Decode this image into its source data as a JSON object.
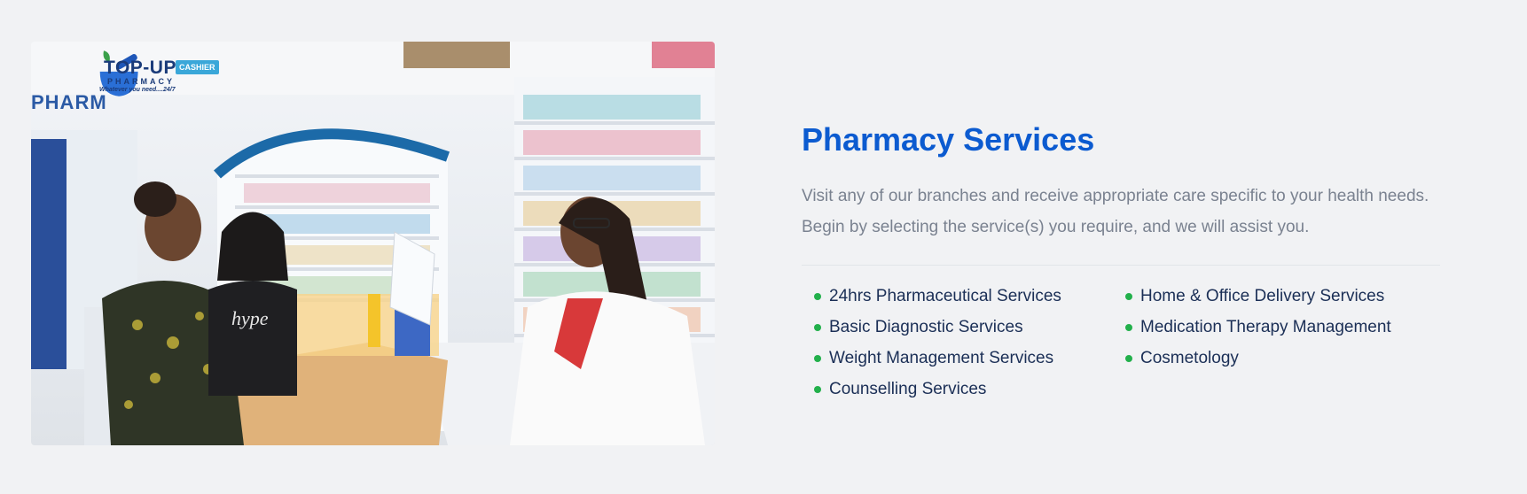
{
  "hero_image": {
    "logo": {
      "title": "TOP-UP",
      "subtitle": "PHARMACY",
      "tagline": "Whatever you need....24/7"
    },
    "signs": {
      "cashier": "CASHIER",
      "pharm": "PHARM"
    },
    "colors": {
      "logo_blue": "#1a3b7a",
      "logo_leaf": "#3aa04a"
    }
  },
  "section": {
    "title": "Pharmacy Services",
    "description": "Visit any of our branches and receive appropriate care specific to your health needs. Begin by selecting the service(s) you require, and we will assist you."
  },
  "services": [
    "24hrs Pharmaceutical Services",
    "Home & Office Delivery Services",
    "Basic Diagnostic Services",
    "Medication Therapy Management",
    "Weight Management Services",
    "Cosmetology",
    "Counselling Services"
  ],
  "colors": {
    "page_background": "#f1f2f4",
    "title": "#0c5bd0",
    "description": "#7a8290",
    "service_text": "#1b2f56",
    "bullet": "#22b04b"
  }
}
